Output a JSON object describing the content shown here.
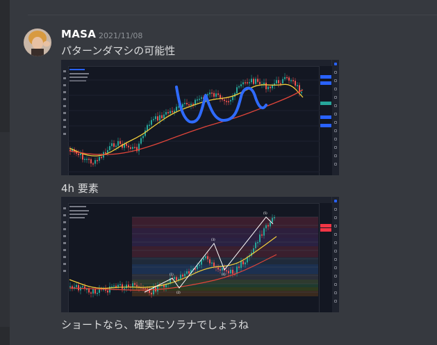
{
  "message": {
    "username": "MASA",
    "timestamp": "2021/11/08",
    "line1": "パターンダマシの可能性",
    "line2": "4h 要素",
    "line3": "ショートなら、確実にソラナでしょうね"
  },
  "colors": {
    "background": "#36393f",
    "username": "#ffffff",
    "text": "#dcddde",
    "timestamp": "#8e9297",
    "chart_bg": "#131722",
    "drawing_blue": "#2f6bff",
    "ma_yellow": "#f5d03b",
    "ma_red": "#e0453a"
  },
  "attachments": {
    "chart1": {
      "annotation": "handwritten W pattern in blue over candlestick chart"
    },
    "chart2": {
      "wave_labels": [
        "(1)",
        "(2)",
        "(3)",
        "(4)",
        "(5)"
      ]
    }
  }
}
